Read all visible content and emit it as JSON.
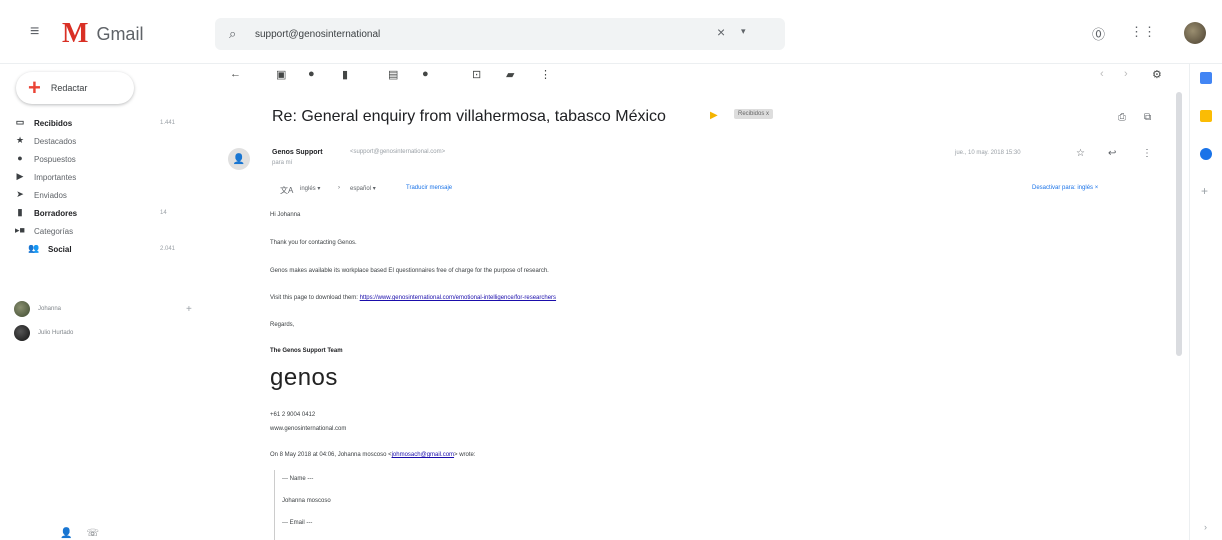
{
  "app": {
    "name": "Gmail",
    "brand_color": "#d93025"
  },
  "search": {
    "value": "support@genosinternational",
    "icon": "search-icon"
  },
  "compose": {
    "label": "Redactar",
    "icon": "plus-icon"
  },
  "sidebar": {
    "items": [
      {
        "label": "Recibidos",
        "count": "1.441",
        "icon": "inbox-icon",
        "bold": true
      },
      {
        "label": "Destacados",
        "count": "",
        "icon": "star-icon",
        "bold": false
      },
      {
        "label": "Pospuestos",
        "count": "",
        "icon": "clock-icon",
        "bold": false
      },
      {
        "label": "Importantes",
        "count": "",
        "icon": "label-important-icon",
        "bold": false
      },
      {
        "label": "Enviados",
        "count": "",
        "icon": "send-icon",
        "bold": false
      },
      {
        "label": "Borradores",
        "count": "14",
        "icon": "draft-icon",
        "bold": true
      },
      {
        "label": "Categorías",
        "count": "",
        "icon": "category-icon",
        "bold": false
      },
      {
        "label": "Social",
        "count": "2.041",
        "icon": "people-icon",
        "bold": true
      }
    ]
  },
  "contacts": [
    {
      "name": "Johanna"
    },
    {
      "name": "Julio Hurtado"
    }
  ],
  "email": {
    "subject": "Re: General enquiry from villahermosa, tabasco México",
    "label_chip": "Recibidos x",
    "sender_name": "Genos Support",
    "sender_email": "<support@genosinternational.com>",
    "to": "para mí",
    "date": "jue., 10 may. 2018 15:30",
    "translate": {
      "from_lang": "inglés",
      "to_lang": "español",
      "translate_link": "Traducir mensaje",
      "disable_link": "Desactivar para: inglés"
    },
    "body": {
      "greeting": "Hi Johanna",
      "line1": "Thank you for contacting Genos.",
      "line2": "Genos makes available its workplace based EI questionnaires free of charge for the purpose of research.",
      "line3_prefix": "Visit this page to download them:",
      "line3_url": "https://www.genosinternational.com/emotional-intelligence/for-researchers",
      "regards": "Regards,",
      "team": "The Genos Support Team",
      "logo_text": "genos",
      "phone": "+61 2 9004 0412",
      "website": "www.genosinternational.com",
      "quote_intro_prefix": "On 8 May 2018 at 04:06, Johanna moscoso <",
      "quote_email": "johmosach@gmail.com",
      "quote_intro_suffix": "> wrote:",
      "quote_name_label": "--- Name ---",
      "quote_name": "Johanna moscoso",
      "quote_email_label": "--- Email ---"
    }
  }
}
